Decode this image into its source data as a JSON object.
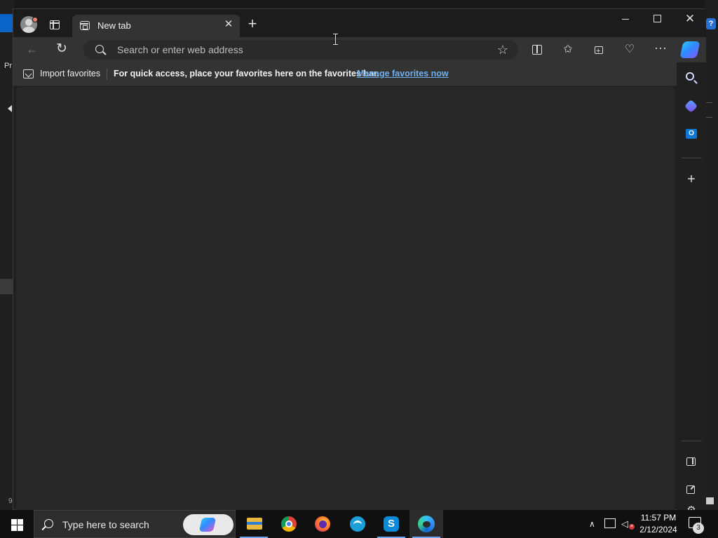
{
  "browser": {
    "tab": {
      "title": "New tab"
    },
    "address_bar": {
      "placeholder": "Search or enter web address"
    },
    "favorites_bar": {
      "import_label": "Import favorites",
      "hint": "For quick access, place your favorites here on the favorites bar.",
      "manage_link": "Manage favorites now"
    }
  },
  "desktop": {
    "left_label": "Pr",
    "left_bottom": "9",
    "help_label": "?"
  },
  "taskbar": {
    "search_placeholder": "Type here to search",
    "apps": [
      "file-explorer",
      "chrome",
      "firefox",
      "finance-app",
      "skype",
      "edge"
    ],
    "clock": {
      "time": "11:57 PM",
      "date": "2/12/2024"
    },
    "notification_count": "3"
  }
}
